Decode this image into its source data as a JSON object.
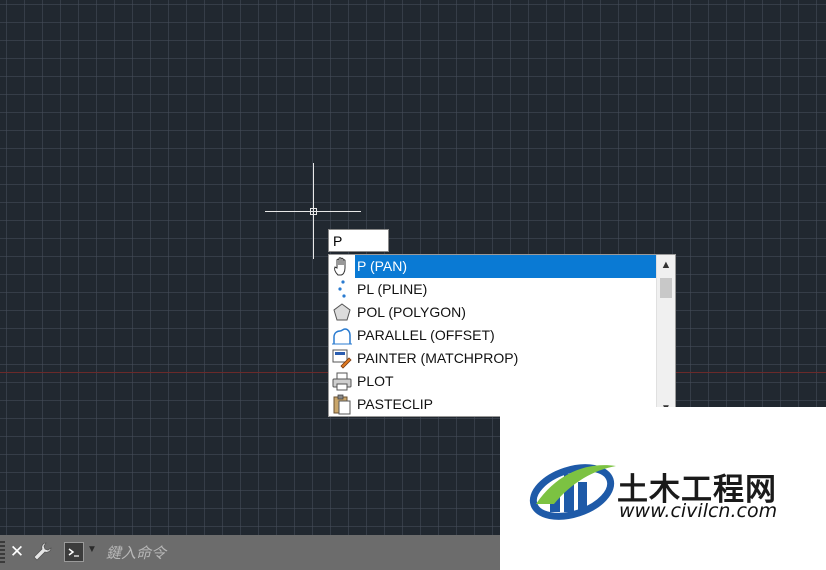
{
  "viewport": {
    "background_color": "#212830",
    "grid_color": "#464e5a",
    "axis_color": "#6b2a2a"
  },
  "dynamic_input": {
    "value": "P"
  },
  "autocomplete": {
    "selected_index": 0,
    "selection_color": "#0a7ad4",
    "items": [
      {
        "label": "P (PAN)",
        "icon": "pan-hand-icon"
      },
      {
        "label": "PL (PLINE)",
        "icon": "polyline-icon"
      },
      {
        "label": "POL (POLYGON)",
        "icon": "polygon-icon"
      },
      {
        "label": "PARALLEL (OFFSET)",
        "icon": "offset-icon"
      },
      {
        "label": "PAINTER (MATCHPROP)",
        "icon": "matchprop-brush-icon"
      },
      {
        "label": "PLOT",
        "icon": "printer-icon"
      },
      {
        "label": "PASTECLIP",
        "icon": "clipboard-icon"
      }
    ]
  },
  "command_line": {
    "placeholder": "鍵入命令",
    "close_glyph": "✕",
    "background_color": "#6c6c6c"
  },
  "watermark": {
    "title": "土木工程网",
    "url": "www.civilcn.com",
    "logo_colors": [
      "#1e5aa8",
      "#7cc242"
    ]
  }
}
